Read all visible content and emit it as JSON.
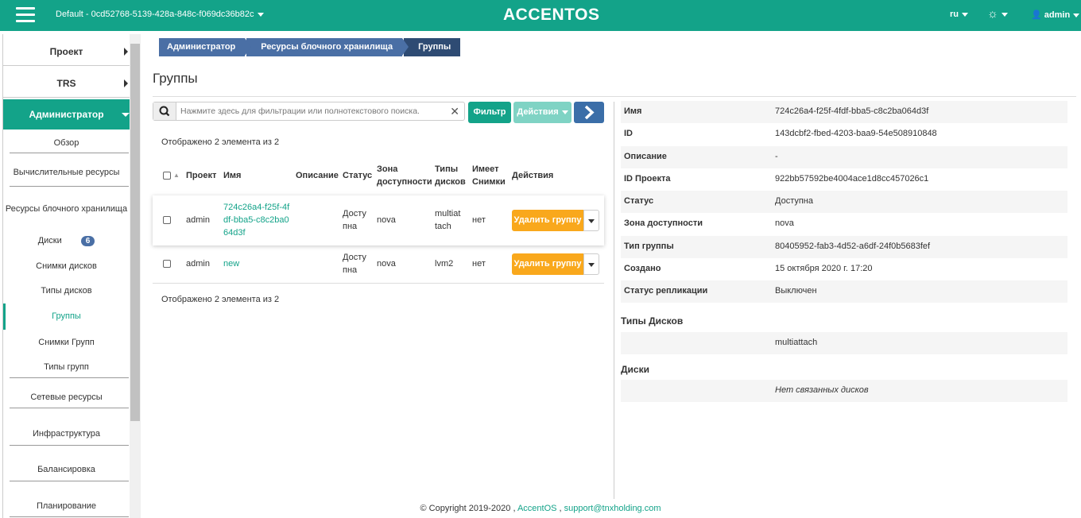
{
  "topbar": {
    "project": "Default - 0cd52768-5139-428a-848c-f069dc36b82c",
    "brand": "ACCENTOS",
    "lang": "ru",
    "user": "admin"
  },
  "sidebar": {
    "project": "Проект",
    "trs": "TRS",
    "admin": "Администратор",
    "overview": "Обзор",
    "compute": "Вычислительные ресурсы",
    "block_storage": "Ресурсы блочного хранилища",
    "disks": "Диски",
    "disks_badge": "6",
    "snapshots": "Снимки дисков",
    "disk_types": "Типы дисков",
    "groups": "Группы",
    "group_snapshots": "Снимки Групп",
    "group_types": "Типы групп",
    "network": "Сетевые ресурсы",
    "infrastructure": "Инфраструктура",
    "balancing": "Балансировка",
    "planning": "Планирование"
  },
  "breadcrumb": [
    "Администратор",
    "Ресурсы блочного хранилища",
    "Группы"
  ],
  "page_title": "Группы",
  "search": {
    "placeholder": "Нажмите здесь для фильтрации или полнотекстового поиска.",
    "filter_label": "Фильтр",
    "actions_label": "Действия"
  },
  "table": {
    "count_top": "Отображено 2 элемента из 2",
    "count_bottom": "Отображено 2 элемента из 2",
    "headers": {
      "project": "Проект",
      "name": "Имя",
      "description": "Описание",
      "status": "Статус",
      "zone_1": "Зона",
      "zone_2": "доступности",
      "types_1": "Типы",
      "types_2": "дисков",
      "snap_1": "Имеет",
      "snap_2": "Снимки",
      "actions": "Действия"
    },
    "rows": [
      {
        "project": "admin",
        "name_1": "724c26a4-f25f-4f",
        "name_2": "df-bba5-c8c2ba0",
        "name_3": "64d3f",
        "status_1": "Досту",
        "status_2": "пна",
        "zone": "nova",
        "types_1": "multiat",
        "types_2": "tach",
        "has_snap": "нет",
        "action": "Удалить группу"
      },
      {
        "project": "admin",
        "name_1": "new",
        "status_1": "Досту",
        "status_2": "пна",
        "zone": "nova",
        "types_1": "lvm2",
        "has_snap": "нет",
        "action": "Удалить группу"
      }
    ]
  },
  "details": {
    "rows": [
      {
        "label": "Имя",
        "value": "724c26a4-f25f-4fdf-bba5-c8c2ba064d3f"
      },
      {
        "label": "ID",
        "value": "143dcbf2-fbed-4203-baa9-54e508910848"
      },
      {
        "label": "Описание",
        "value": "-"
      },
      {
        "label": "ID Проекта",
        "value": "922bb57592be4004ace1d8cc457026c1"
      },
      {
        "label": "Статус",
        "value": "Доступна"
      },
      {
        "label": "Зона доступности",
        "value": "nova"
      },
      {
        "label": "Тип группы",
        "value": "80405952-fab3-4d52-a6df-24f0b5683fef"
      },
      {
        "label": "Создано",
        "value": "15 октября 2020 г. 17:20"
      },
      {
        "label": "Статус репликации",
        "value": "Выключен"
      }
    ],
    "disk_types_title": "Типы Дисков",
    "disk_types_value": "multiattach",
    "disks_title": "Диски",
    "disks_value": "Нет связанных дисков"
  },
  "footer": {
    "copyright": "© Copyright 2019-2020 ,",
    "accentos": "AccentOS",
    "sep": ",",
    "email": "support@tnxholding.com"
  },
  "colors": {
    "accent": "#13a389",
    "breadcrumb": "#4a6fa5",
    "delete": "#f9a81c",
    "next": "#3b6ea8"
  }
}
